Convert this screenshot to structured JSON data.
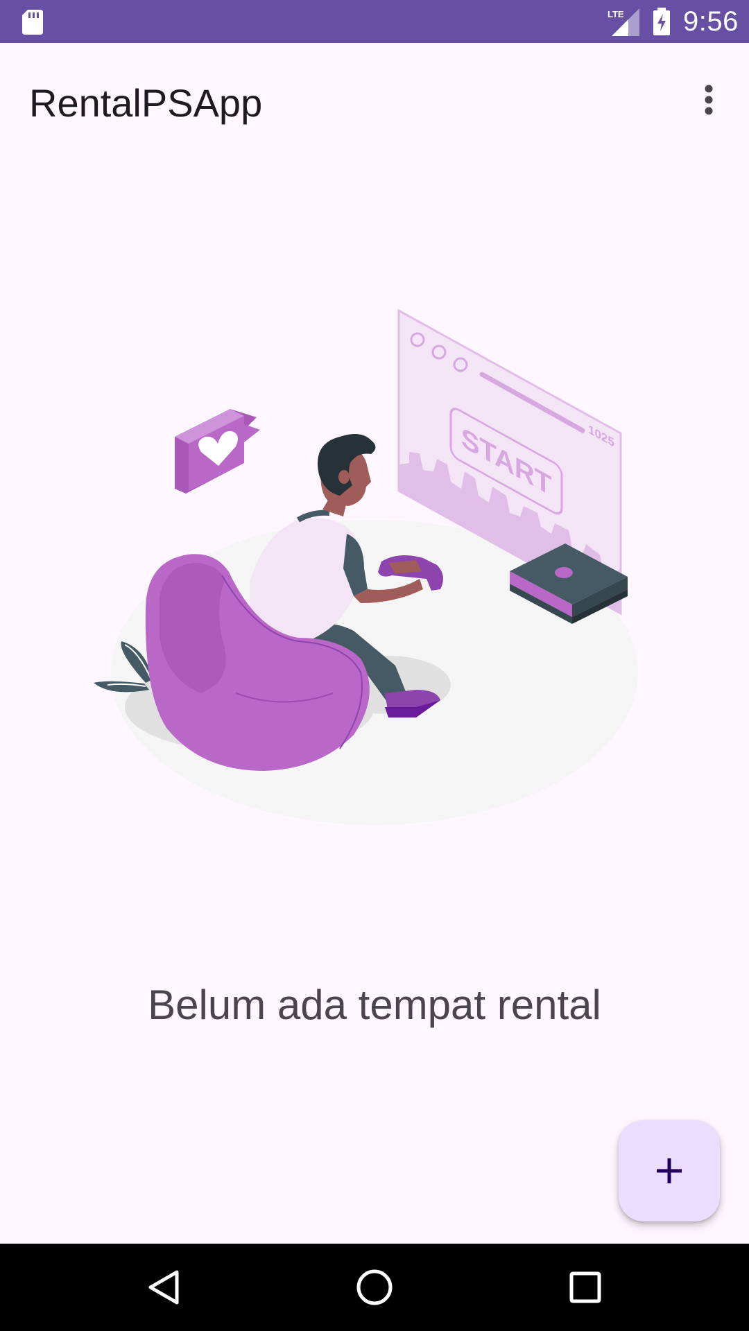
{
  "status_bar": {
    "time": "9:56",
    "network_label": "LTE",
    "icons": [
      "sd-card-icon",
      "lte-signal-icon",
      "battery-charging-icon"
    ],
    "background": "#6750A4"
  },
  "app_bar": {
    "title": "RentalPSApp",
    "menu_icon": "more-vert-icon"
  },
  "illustration": {
    "subject": "person-playing-console-icon",
    "screen_text": "START",
    "screen_score": "1025",
    "accent": "#BA68C8"
  },
  "main": {
    "empty_message": "Belum ada tempat rental"
  },
  "fab": {
    "icon": "add-icon",
    "background": "#EADDFF",
    "icon_color": "#21005D"
  },
  "nav_bar": {
    "buttons": [
      "back-icon",
      "home-icon",
      "recents-icon"
    ]
  }
}
